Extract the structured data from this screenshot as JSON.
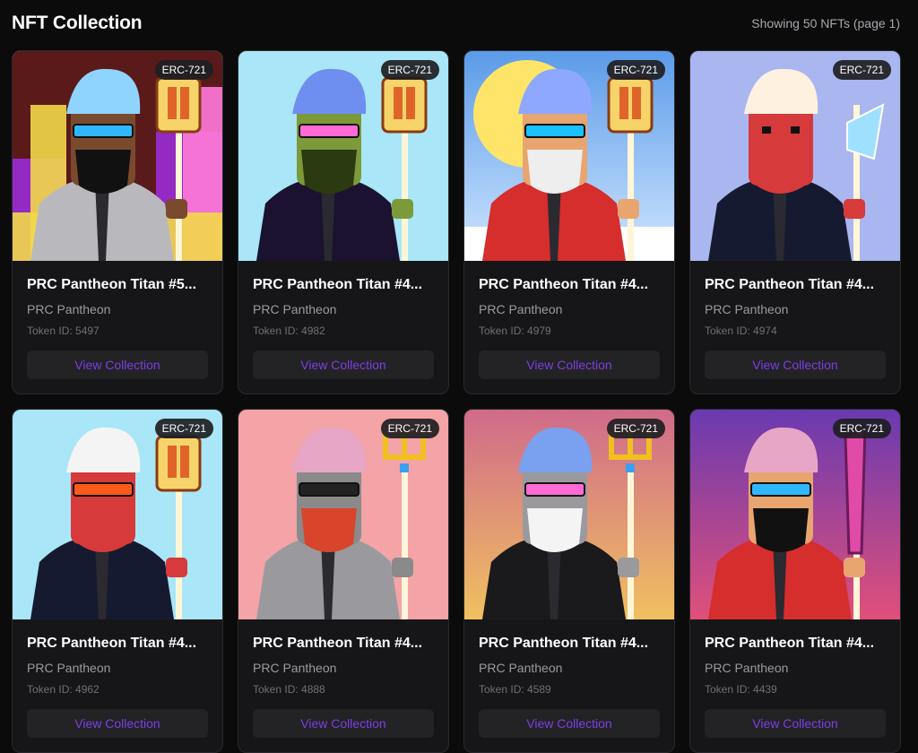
{
  "header": {
    "title": "NFT Collection",
    "count_text": "Showing 50 NFTs (page 1)"
  },
  "token_prefix": "Token ID: ",
  "cards": [
    {
      "title": "PRC Pantheon Titan #5...",
      "collection": "PRC Pantheon",
      "token": "5497",
      "badge": "ERC-721",
      "button": "View Collection",
      "art": {
        "bg": "flames",
        "bg1": "#f2d84b",
        "bg2": "#9a2bd6",
        "skin": "#7a4a2e",
        "hair": "#8fd3ff",
        "suit": "#b9b9bd",
        "beard": "#111111",
        "eyewear": "shades-blue",
        "weapon": "torch"
      }
    },
    {
      "title": "PRC Pantheon Titan #4...",
      "collection": "PRC Pantheon",
      "token": "4982",
      "badge": "ERC-721",
      "button": "View Collection",
      "art": {
        "bg": "plain",
        "bg1": "#a9e6f7",
        "bg2": "#a9e6f7",
        "skin": "#7c9a3a",
        "hair": "#6f8ff0",
        "suit": "#1a1230",
        "beard": "#2b3a10",
        "eyewear": "shades-pink",
        "weapon": "torch"
      }
    },
    {
      "title": "PRC Pantheon Titan #4...",
      "collection": "PRC Pantheon",
      "token": "4979",
      "badge": "ERC-721",
      "button": "View Collection",
      "art": {
        "bg": "sun",
        "bg1": "#5b9be9",
        "bg2": "#ffe46a",
        "skin": "#e8a570",
        "hair": "#8ea8ff",
        "suit": "#d62d2d",
        "beard": "#eeeeee",
        "eyewear": "visor-blue",
        "weapon": "torch"
      }
    },
    {
      "title": "PRC Pantheon Titan #4...",
      "collection": "PRC Pantheon",
      "token": "4974",
      "badge": "ERC-721",
      "button": "View Collection",
      "art": {
        "bg": "plain",
        "bg1": "#aab6f0",
        "bg2": "#aab6f0",
        "skin": "#d63a3a",
        "hair": "#fff1e0",
        "suit": "#161a30",
        "beard": "#d63a3a",
        "eyewear": "none",
        "weapon": "axe"
      }
    },
    {
      "title": "PRC Pantheon Titan #4...",
      "collection": "PRC Pantheon",
      "token": "4962",
      "badge": "ERC-721",
      "button": "View Collection",
      "art": {
        "bg": "plain",
        "bg1": "#a9e6f7",
        "bg2": "#a9e6f7",
        "skin": "#d63a3a",
        "hair": "#f4f4f4",
        "suit": "#161a30",
        "beard": "#d63a3a",
        "eyewear": "shades-red",
        "weapon": "torch"
      }
    },
    {
      "title": "PRC Pantheon Titan #4...",
      "collection": "PRC Pantheon",
      "token": "4888",
      "badge": "ERC-721",
      "button": "View Collection",
      "art": {
        "bg": "plain",
        "bg1": "#f4a3a6",
        "bg2": "#f4a3a6",
        "skin": "#8a8a8a",
        "hair": "#e8a6c6",
        "suit": "#9a9a9e",
        "beard": "#d8452a",
        "eyewear": "shades-dark",
        "weapon": "trident"
      }
    },
    {
      "title": "PRC Pantheon Titan #4...",
      "collection": "PRC Pantheon",
      "token": "4589",
      "badge": "ERC-721",
      "button": "View Collection",
      "art": {
        "bg": "gradient",
        "bg1": "#d06a8a",
        "bg2": "#f0c060",
        "skin": "#9a9a9e",
        "hair": "#7aa0f0",
        "suit": "#1a1a1c",
        "beard": "#f4f4f4",
        "eyewear": "shades-pink",
        "weapon": "trident"
      }
    },
    {
      "title": "PRC Pantheon Titan #4...",
      "collection": "PRC Pantheon",
      "token": "4439",
      "badge": "ERC-721",
      "button": "View Collection",
      "art": {
        "bg": "gradient",
        "bg1": "#6a3ab0",
        "bg2": "#e0507a",
        "skin": "#e8a570",
        "hair": "#e8a6c6",
        "suit": "#d62d2d",
        "beard": "#111111",
        "eyewear": "shades-blue",
        "weapon": "sword"
      }
    }
  ]
}
